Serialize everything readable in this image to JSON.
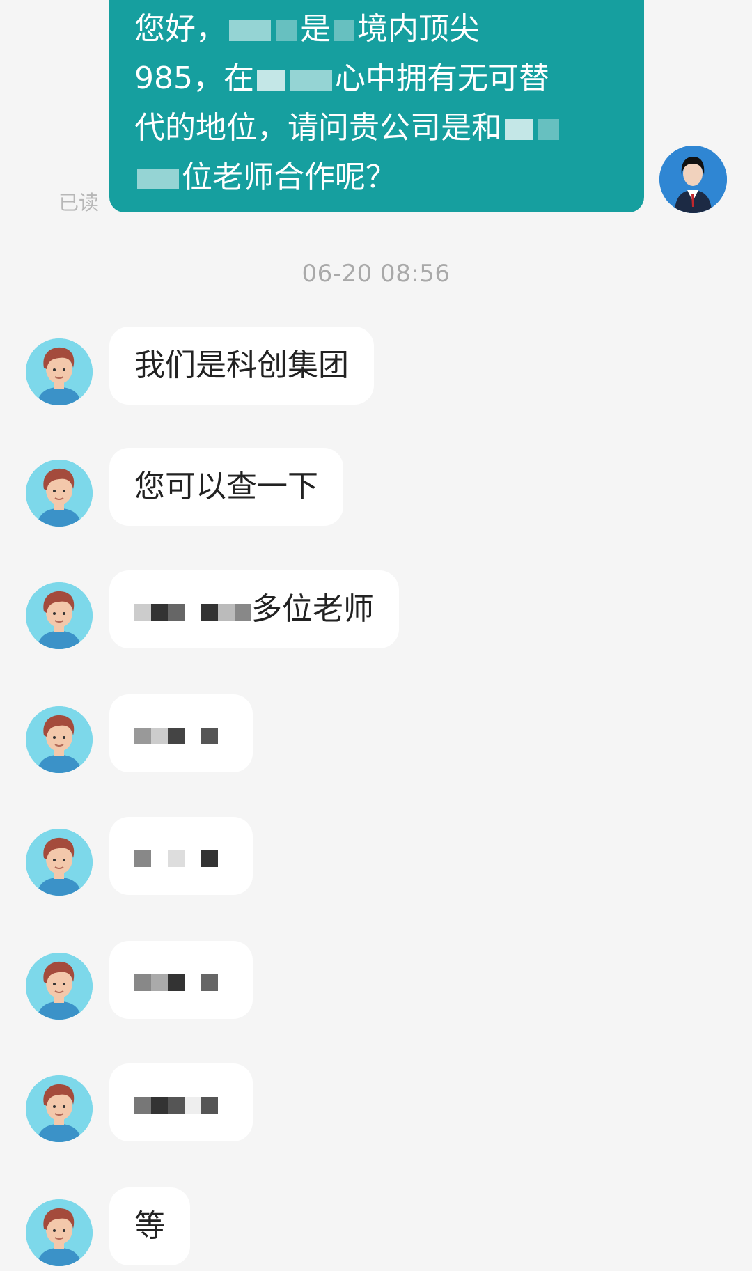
{
  "outgoing": {
    "lines": [
      "您好，",
      "是",
      "境内顶尖",
      "985，在",
      "心中拥有无可替",
      "代的地位，请问贵公司是和",
      "位老师合作呢？"
    ],
    "read_status": "已读"
  },
  "timestamp": "06-20 08:56",
  "incoming": [
    {
      "text": "我们是科创集团"
    },
    {
      "text": "您可以查一下"
    },
    {
      "text": "多位老师"
    },
    {
      "text": ""
    },
    {
      "text": ""
    },
    {
      "text": ""
    },
    {
      "text": ""
    },
    {
      "text": "等"
    }
  ],
  "colors": {
    "outgoing_bubble": "#169f9f",
    "incoming_bubble": "#ffffff",
    "background": "#f5f5f5",
    "incoming_avatar": "#7dd8ea",
    "my_avatar": "#2f86d3"
  },
  "icons": {
    "incoming_avatar": "cartoon-man-avatar-icon",
    "my_avatar": "profile-photo-avatar-icon"
  }
}
